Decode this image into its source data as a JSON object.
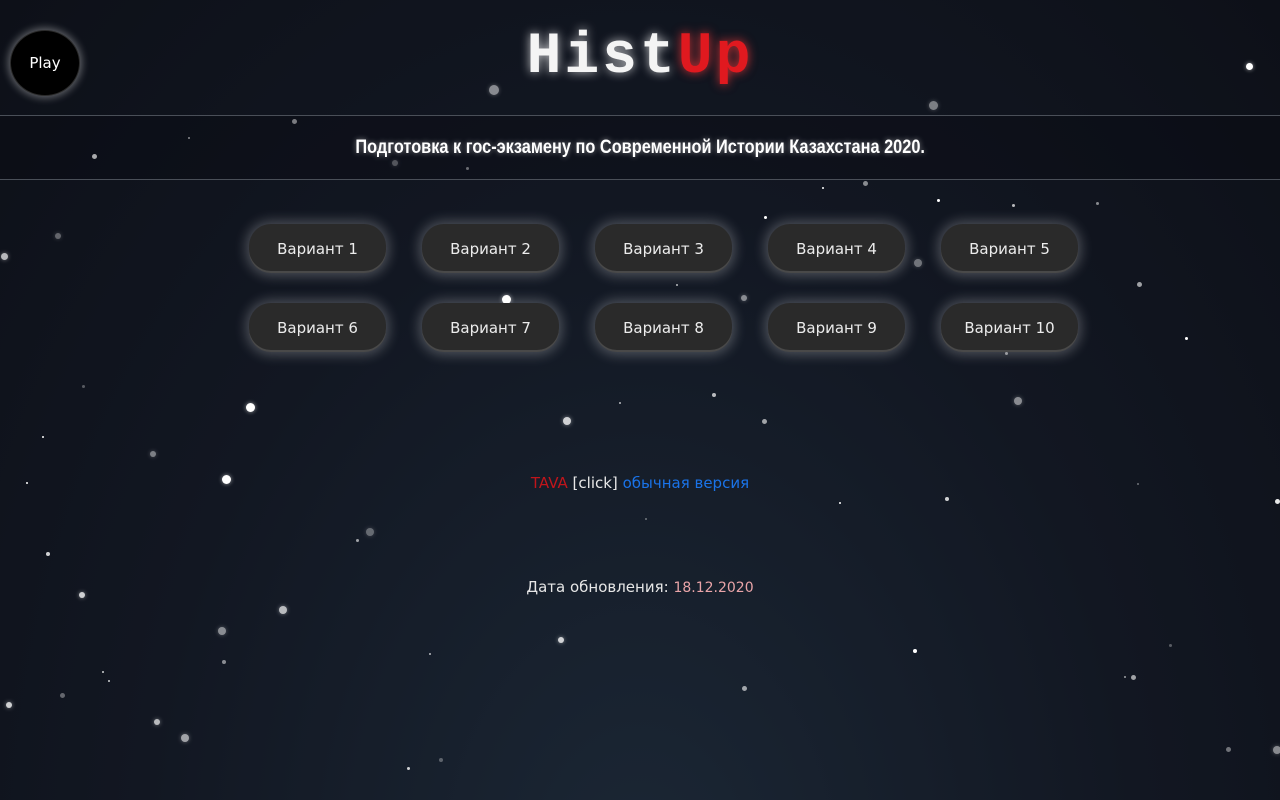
{
  "player": {
    "play_label": "Play"
  },
  "logo": {
    "part1": "Hist",
    "part2": "Up"
  },
  "banner": {
    "text": "Подготовка к гос-экзамену по Современной Истории Казахстана 2020."
  },
  "variants": [
    "Вариант 1",
    "Вариант 2",
    "Вариант 3",
    "Вариант 4",
    "Вариант 5",
    "Вариант 6",
    "Вариант 7",
    "Вариант 8",
    "Вариант 9",
    "Вариант 10"
  ],
  "links": {
    "tava": "TAVA",
    "click": "[click]",
    "normal_version": "обычная версия"
  },
  "update": {
    "label": "Дата обновления:",
    "date": "18.12.2020"
  },
  "colors": {
    "background": "#121722",
    "logo_white": "#f4f4f4",
    "logo_red": "#e0191f",
    "button_bg": "#2a2a2a",
    "link_blue": "#1a73e8",
    "tava_red": "#c0151b",
    "date_pink": "#e9a4a8"
  }
}
